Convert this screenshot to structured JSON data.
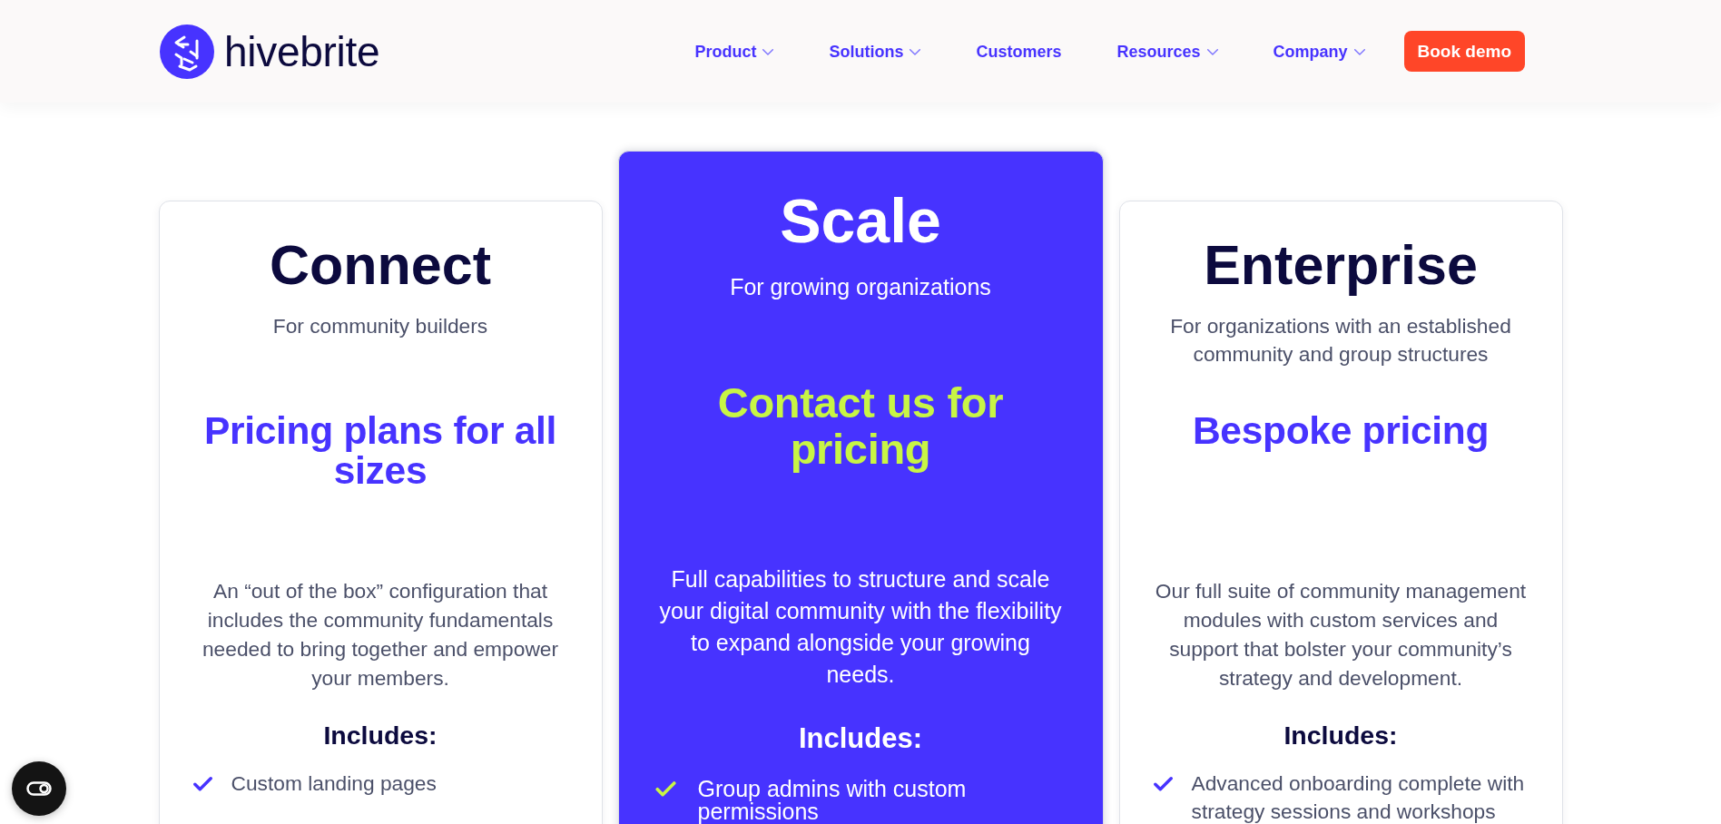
{
  "header": {
    "logo": {
      "text": "hivebrite"
    },
    "nav": [
      {
        "label": "Product",
        "dropdown": true
      },
      {
        "label": "Solutions",
        "dropdown": true
      },
      {
        "label": "Customers",
        "dropdown": false
      },
      {
        "label": "Resources",
        "dropdown": true
      },
      {
        "label": "Company",
        "dropdown": true
      }
    ],
    "cta": {
      "label": "Book demo"
    }
  },
  "plans": [
    {
      "name": "Connect",
      "tagline": "For community builders",
      "highlighted": false,
      "price": "Pricing plans for all sizes",
      "description": "An “out of the box” configuration that includes the community fundamentals needed to bring together and empower your members.",
      "includes_title": "Includes:",
      "features": [
        "Custom landing pages"
      ]
    },
    {
      "name": "Scale",
      "tagline": "For growing organizations",
      "highlighted": true,
      "price": "Contact us for pricing",
      "description": "Full capabilities to structure and scale your digital community with the flexibility to expand alongside your growing needs.",
      "includes_title": "Includes:",
      "features": [
        "Group admins with custom permissions"
      ]
    },
    {
      "name": "Enterprise",
      "tagline": "For organizations with an established community and group structures",
      "highlighted": false,
      "price": "Bespoke pricing",
      "description": "Our full suite of community management modules with custom services and support that bolster your community’s strategy and development.",
      "includes_title": "Includes:",
      "features": [
        "Advanced onboarding complete with strategy sessions and workshops"
      ]
    }
  ]
}
